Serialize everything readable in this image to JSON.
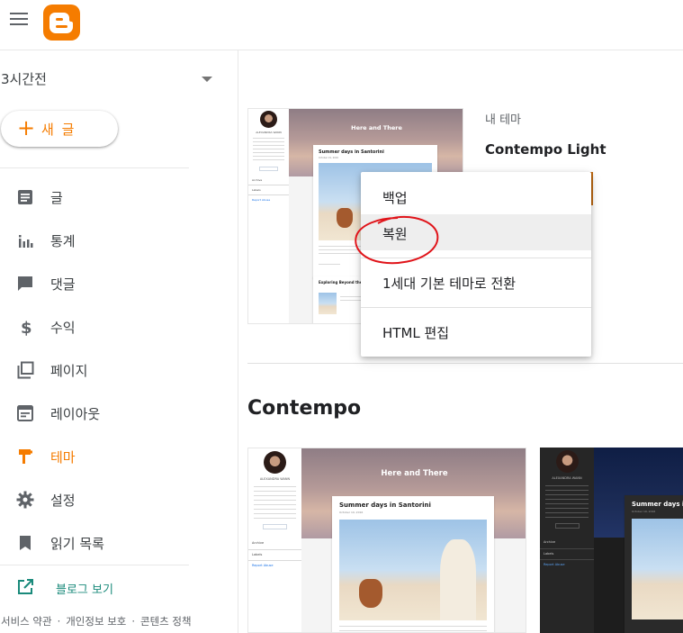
{
  "app": {
    "name": "Blogger",
    "brand_color": "#f57c00"
  },
  "topbar": {
    "menu_icon": "hamburger-menu-icon",
    "logo_icon": "blogger-logo-icon"
  },
  "sidebar": {
    "blog_selector": {
      "value": "3시간전"
    },
    "new_post_label": "새 글",
    "items": [
      {
        "label": "글",
        "icon": "posts-icon"
      },
      {
        "label": "통계",
        "icon": "stats-icon"
      },
      {
        "label": "댓글",
        "icon": "comments-icon"
      },
      {
        "label": "수익",
        "icon": "earnings-icon"
      },
      {
        "label": "페이지",
        "icon": "pages-icon"
      },
      {
        "label": "레이아웃",
        "icon": "layout-icon"
      },
      {
        "label": "테마",
        "icon": "theme-icon",
        "active": true
      },
      {
        "label": "설정",
        "icon": "settings-icon"
      },
      {
        "label": "읽기 목록",
        "icon": "reading-list-icon"
      }
    ],
    "view_blog_label": "블로그 보기",
    "footer": {
      "terms": "서비스 약관",
      "privacy": "개인정보 보호",
      "content_policy": "콘텐츠 정책"
    }
  },
  "main": {
    "my_theme_label": "내 테마",
    "my_theme_name": "Contempo Light",
    "section_title": "Contempo"
  },
  "thumbnail": {
    "blog_title": "Here and There",
    "post_title": "Summer days in Santorini",
    "second_post_title": "Exploring Beyond the",
    "author": "ALEXANDRA WANN",
    "archive": "Archive",
    "labels": "Labels",
    "report_abuse": "Report Abuse",
    "visit_button": "VISIT PROFILE",
    "date": "October 19, 2016",
    "dark_bg": "#1d1d1d",
    "hero_night": "#1b2b55"
  },
  "menu": {
    "items": [
      {
        "label": "백업"
      },
      {
        "label": "복원",
        "highlighted": true
      },
      {
        "label": "1세대 기본 테마로 전환"
      },
      {
        "label": "HTML 편집"
      }
    ]
  },
  "annotation": {
    "color": "#e0141a"
  }
}
